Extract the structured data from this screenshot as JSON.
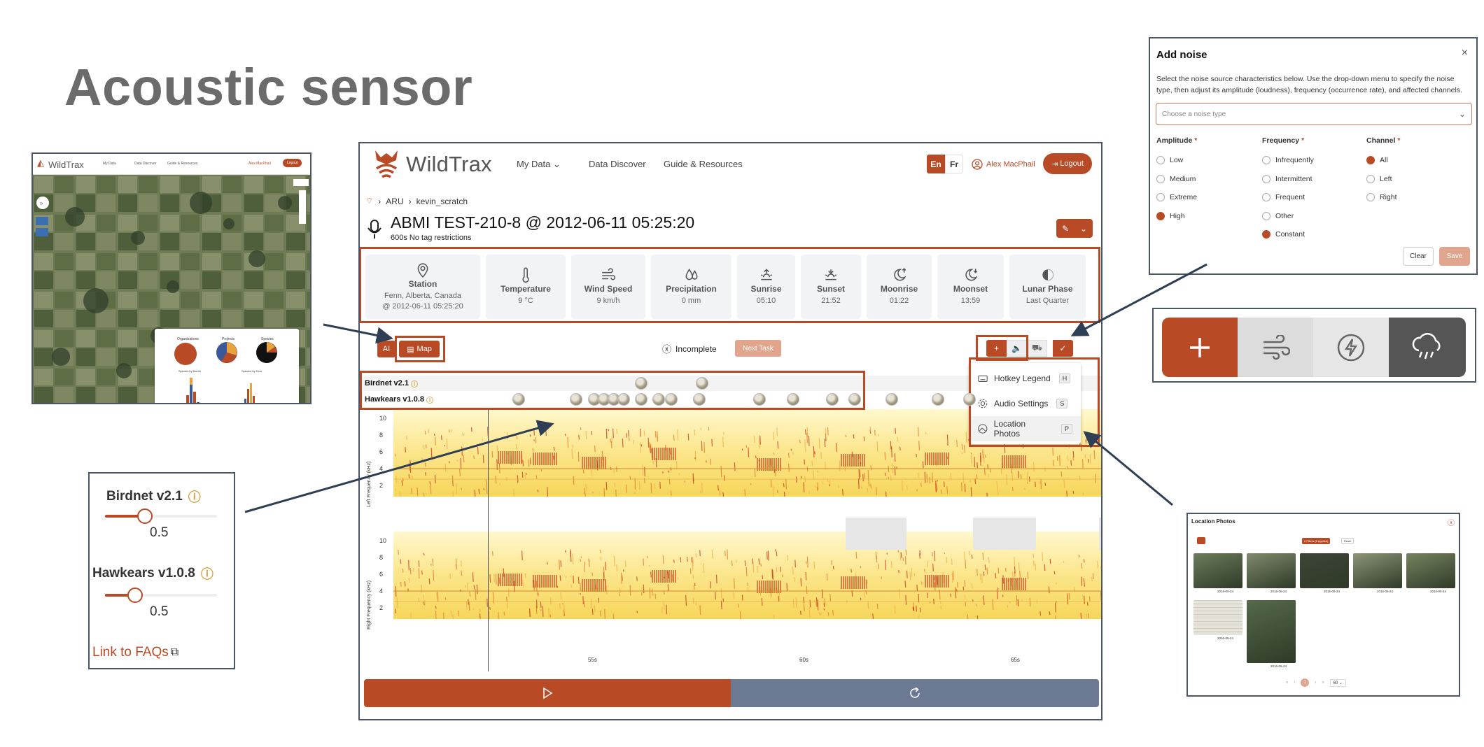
{
  "slide": {
    "title": "Acoustic sensor"
  },
  "app": {
    "brand": "WildTrax",
    "nav": {
      "my_data": "My Data",
      "data_discover": "Data Discover",
      "guide": "Guide & Resources"
    },
    "lang": {
      "en": "En",
      "fr": "Fr"
    },
    "user": "Alex MacPhail",
    "logout": "Logout",
    "breadcrumb": [
      "ARU",
      "kevin_scratch"
    ],
    "task": {
      "title": "ABMI TEST-210-8 @ 2012-06-11 05:25:20",
      "subtitle": "600s No tag restrictions"
    },
    "weather": [
      {
        "icon": "map-pin-icon",
        "label": "Station",
        "lines": [
          "Fenn, Alberta, Canada",
          "@ 2012-06-11 05:25:20"
        ]
      },
      {
        "icon": "thermometer-icon",
        "label": "Temperature",
        "lines": [
          "9 °C"
        ]
      },
      {
        "icon": "wind-icon",
        "label": "Wind Speed",
        "lines": [
          "9 km/h"
        ]
      },
      {
        "icon": "droplets-icon",
        "label": "Precipitation",
        "lines": [
          "0 mm"
        ]
      },
      {
        "icon": "sunrise-icon",
        "label": "Sunrise",
        "lines": [
          "05:10"
        ]
      },
      {
        "icon": "sunset-icon",
        "label": "Sunset",
        "lines": [
          "21:52"
        ]
      },
      {
        "icon": "moonrise-icon",
        "label": "Moonrise",
        "lines": [
          "01:22"
        ]
      },
      {
        "icon": "moonset-icon",
        "label": "Moonset",
        "lines": [
          "13:59"
        ]
      },
      {
        "icon": "half-moon-icon",
        "label": "Lunar Phase",
        "lines": [
          "Last Quarter"
        ]
      }
    ],
    "toolbar": {
      "ai": "AI",
      "map": "Map",
      "status": "Incomplete",
      "next_task": "Next Task",
      "check": "✓"
    },
    "menu": [
      {
        "icon": "keyboard-icon",
        "label": "Hotkey Legend",
        "key": "H"
      },
      {
        "icon": "gear-icon",
        "label": "Audio Settings",
        "key": "S"
      },
      {
        "icon": "image-icon",
        "label": "Location Photos",
        "key": "P"
      }
    ],
    "classifiers": [
      "Birdnet v2.1",
      "Hawkears v1.0.8"
    ],
    "spectrogram": {
      "left_label": "Left Frequency (kHz)",
      "right_label": "Right Frequency (kHz)",
      "yticks": [
        "10",
        "8",
        "6",
        "4",
        "2"
      ],
      "xticks": [
        "55s",
        "60s",
        "65s"
      ]
    }
  },
  "zoom_classifier": {
    "items": [
      {
        "name": "Birdnet v2.1",
        "value": "0.5",
        "fill": 0.37
      },
      {
        "name": "Hawkears v1.0.8",
        "value": "0.5",
        "fill": 0.27
      }
    ],
    "faq": "Link to FAQs"
  },
  "noise_dialog": {
    "title": "Add noise",
    "close": "×",
    "description": "Select the noise source characteristics below. Use the drop-down menu to specify the noise type, then adjust its amplitude (loudness), frequency (occurrence rate), and affected channels.",
    "placeholder": "Choose a noise type",
    "amplitude": {
      "label": "Amplitude",
      "options": [
        "Low",
        "Medium",
        "Extreme",
        "High"
      ],
      "selected": "High"
    },
    "frequency": {
      "label": "Frequency",
      "options": [
        "Infrequently",
        "Intermittent",
        "Frequent",
        "Other",
        "Constant"
      ],
      "selected": "Constant"
    },
    "channel": {
      "label": "Channel",
      "options": [
        "All",
        "Left",
        "Right"
      ],
      "selected": "All"
    },
    "clear": "Clear",
    "save": "Save"
  },
  "noise_toolbar": {
    "icons": [
      "plus-icon",
      "wind-icon",
      "lightning-icon",
      "rain-cloud-icon"
    ]
  },
  "mini_map": {
    "brand": "WildTrax",
    "nav": [
      "My Data",
      "Data Discover",
      "Guide & Resources"
    ],
    "user": "Alex MacPhail",
    "logout": "Logout",
    "charts": [
      "Organizations",
      "Projects",
      "Species",
      "Species by Month",
      "Species by Hour"
    ]
  },
  "location_photos": {
    "title": "Location Photos",
    "filter": "0 Filters (1 Applied)",
    "reset": "Reset",
    "page_size": "60",
    "current_page": "1",
    "date": "2016-06-24"
  },
  "colors": {
    "accent": "#b94a26",
    "slate": "#6b7a92",
    "frame": "#4a5568"
  }
}
